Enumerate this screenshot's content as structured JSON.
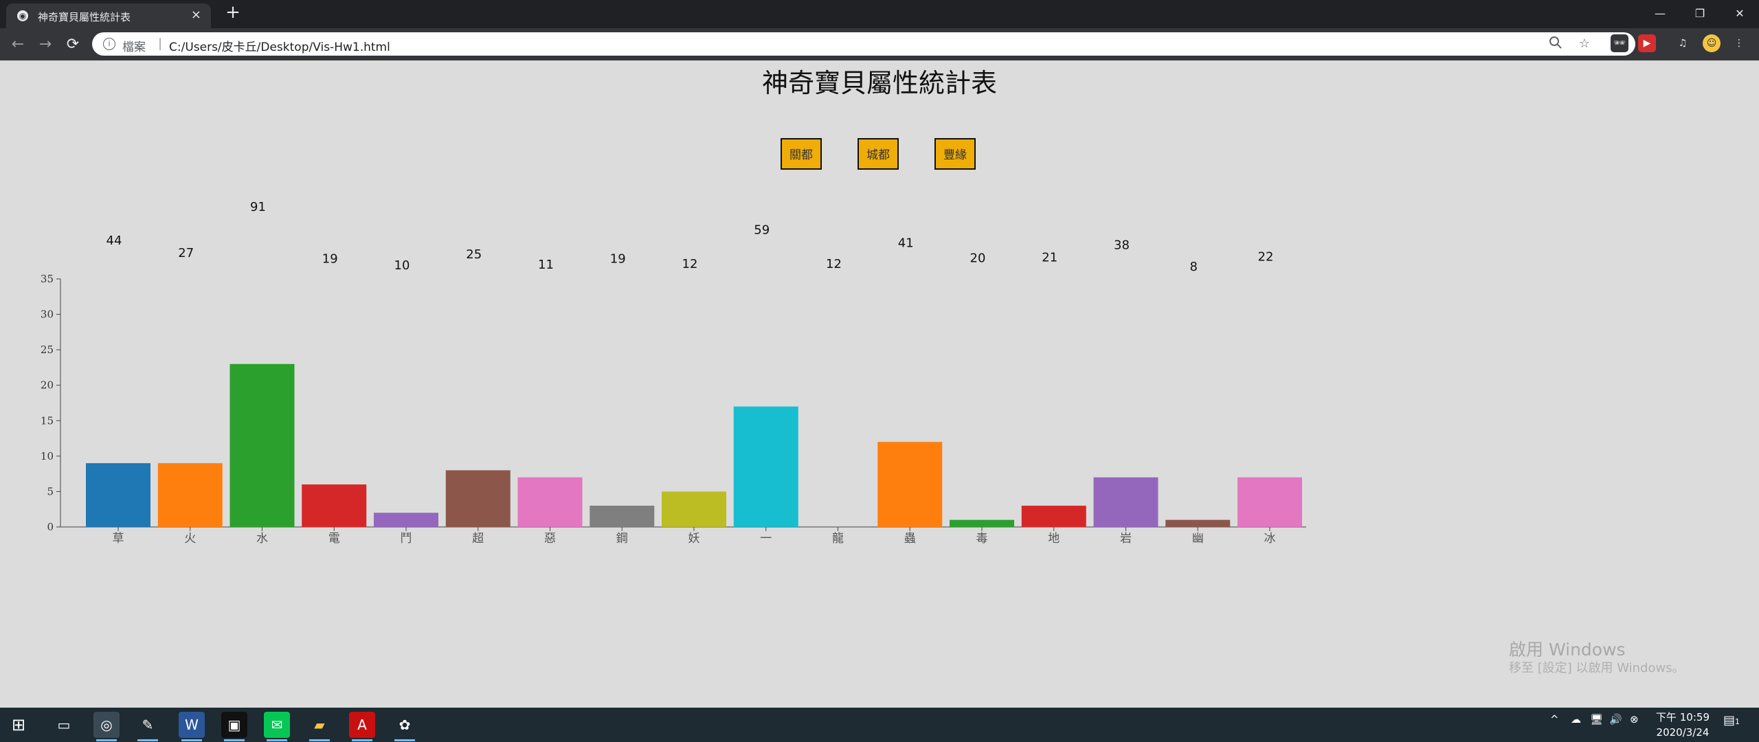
{
  "browser": {
    "tab_title": "神奇寶貝屬性統計表",
    "tab_close": "×",
    "new_tab": "+",
    "win_min": "—",
    "win_max": "❐",
    "win_close": "✕",
    "back": "←",
    "forward": "→",
    "reload": "⟳",
    "omnibox_label": "檔案",
    "omnibox_sep": "|",
    "url": "C:/Users/皮卡丘/Desktop/Vis-Hw1.html",
    "icons": [
      "zoom-icon",
      "star-icon",
      "spy-extension-icon",
      "red-extension-icon",
      "media-control-icon",
      "profile-avatar-icon",
      "menu-kebab-icon"
    ]
  },
  "page": {
    "title": "神奇寶貝屬性統計表",
    "buttons": [
      "關都",
      "城都",
      "豐緣"
    ]
  },
  "chart_data": {
    "type": "bar",
    "title": "",
    "xlabel": "",
    "ylabel": "",
    "categories": [
      "草",
      "火",
      "水",
      "電",
      "鬥",
      "超",
      "惡",
      "鋼",
      "妖",
      "一",
      "龍",
      "蟲",
      "毒",
      "地",
      "岩",
      "幽",
      "冰"
    ],
    "values": [
      9,
      9,
      23,
      6,
      2,
      8,
      7,
      3,
      5,
      17,
      0,
      12,
      1,
      3,
      7,
      1,
      7
    ],
    "labels": [
      "44",
      "27",
      "91",
      "19",
      "10",
      "25",
      "11",
      "19",
      "12",
      "59",
      "12",
      "41",
      "20",
      "21",
      "38",
      "8",
      "22"
    ],
    "colors": [
      "#1f77b4",
      "#ff7f0e",
      "#2ca02c",
      "#d62728",
      "#9467bd",
      "#8c564b",
      "#e377c2",
      "#7f7f7f",
      "#bcbd22",
      "#17becf",
      "#1f77b4",
      "#ff7f0e",
      "#2ca02c",
      "#d62728",
      "#9467bd",
      "#8c564b",
      "#e377c2"
    ],
    "ylim": [
      0,
      35
    ],
    "yticks": [
      "0",
      "5",
      "10",
      "15",
      "20",
      "25",
      "30",
      "35"
    ],
    "grid": false
  },
  "watermark": {
    "line1": "啟用 Windows",
    "line2": "移至 [設定] 以啟用 Windows。"
  },
  "taskbar": {
    "apps": [
      "windows-start-icon",
      "desktop-icon",
      "chrome-icon",
      "notepad-icon",
      "word-icon",
      "terminal-icon",
      "line-icon",
      "file-explorer-icon",
      "acrobat-icon",
      "paint-icon"
    ],
    "tray": [
      "^",
      "☁",
      "🖥",
      "🔊",
      "⊗"
    ],
    "time": "下午 10:59",
    "date": "2020/3/24",
    "notification": "1"
  }
}
